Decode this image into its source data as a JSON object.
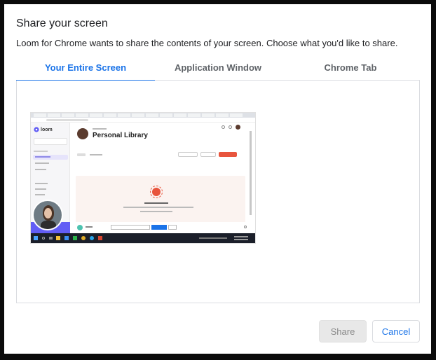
{
  "dialog": {
    "title": "Share your screen",
    "description": "Loom for Chrome wants to share the contents of your screen. Choose what you'd like to share."
  },
  "tabs": [
    {
      "label": "Your Entire Screen",
      "active": true
    },
    {
      "label": "Application Window",
      "active": false
    },
    {
      "label": "Chrome Tab",
      "active": false
    }
  ],
  "preview": {
    "page_heading": "Personal Library",
    "brand": "loom"
  },
  "buttons": {
    "share": "Share",
    "cancel": "Cancel"
  },
  "colors": {
    "accent": "#1a73e8",
    "loom_red": "#e8553d",
    "loom_purple": "#625df5"
  }
}
